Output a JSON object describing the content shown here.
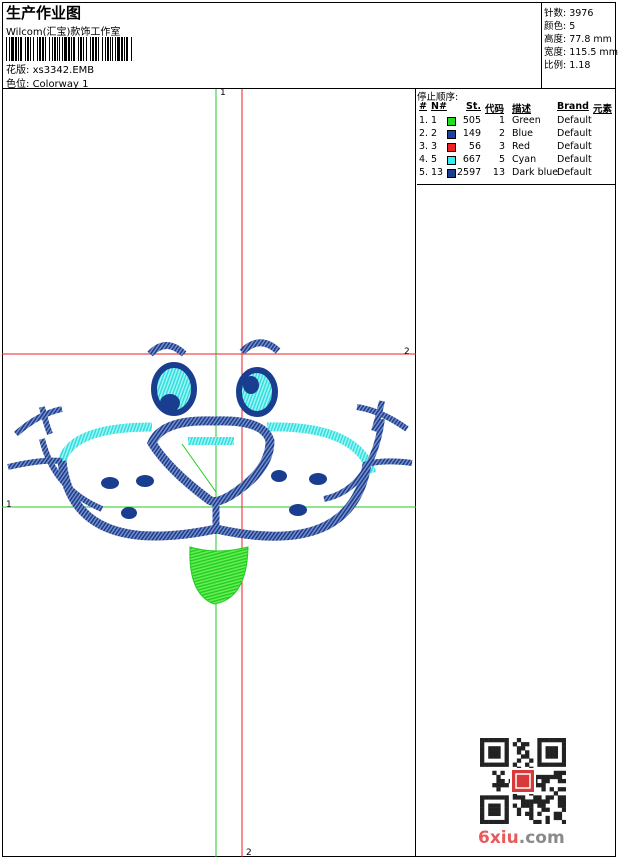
{
  "header": {
    "title": "生产作业图",
    "company": "Wilcom(汇宝)款饰工作室",
    "pattern_label": "花版:",
    "pattern_value": "xs3342.EMB",
    "colorway_label": "色位:",
    "colorway_value": "Colorway 1"
  },
  "stats": {
    "stitches": "针数: 3976",
    "colors": "颜色: 5",
    "height": "高度: 77.8 mm",
    "width": "宽度: 115.5 mm",
    "scale": "比例: 1.18"
  },
  "stop_sequence": {
    "title": "停止顺序:",
    "headers": [
      "#",
      "N#",
      "St.",
      "代码",
      "描述",
      "Brand",
      "元素"
    ],
    "rows": [
      {
        "idx": "1.",
        "n": "1",
        "color": "#22dd22",
        "st": "505",
        "code": "1",
        "desc": "Green",
        "brand": "Default"
      },
      {
        "idx": "2.",
        "n": "2",
        "color": "#1c3fa0",
        "st": "149",
        "code": "2",
        "desc": "Blue",
        "brand": "Default"
      },
      {
        "idx": "3.",
        "n": "3",
        "color": "#ee2222",
        "st": "56",
        "code": "3",
        "desc": "Red",
        "brand": "Default"
      },
      {
        "idx": "4.",
        "n": "5",
        "color": "#33eeee",
        "st": "667",
        "code": "5",
        "desc": "Cyan",
        "brand": "Default"
      },
      {
        "idx": "5.",
        "n": "13",
        "color": "#1a3e8f",
        "st": "2597",
        "code": "13",
        "desc": "Dark blue",
        "brand": "Default"
      }
    ]
  },
  "axes": {
    "v1": "1",
    "h1": "1",
    "h2": "2",
    "v2": "2"
  },
  "watermark": {
    "main": "6xiu",
    "suffix": ".com"
  }
}
